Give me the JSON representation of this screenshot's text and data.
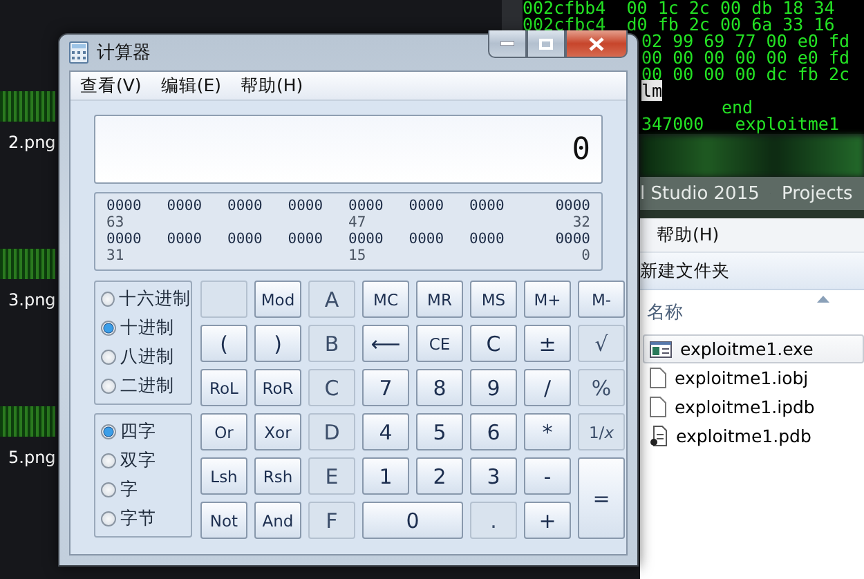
{
  "desktop_icons": [
    {
      "label": "2.png"
    },
    {
      "label": "3.png"
    },
    {
      "label": "5.png"
    }
  ],
  "terminal": {
    "lines": [
      {
        "text": "002cfbb4  00 1c 2c 00 db 18 34",
        "kind": "row",
        "highlighted": false
      },
      {
        "text": "002cfbc4  d0 fb 2c 00 6a 33 16",
        "kind": "row",
        "highlighted": false
      },
      {
        "text": "02 99 69 77 00 e0 fd",
        "kind": "tail",
        "highlighted": false
      },
      {
        "text": "00 00 00 00 00 e0 fd",
        "kind": "tail",
        "highlighted": false
      },
      {
        "text": "00 00 00 00 dc fb 2c",
        "kind": "tail",
        "highlighted": false
      },
      {
        "text": "lm",
        "kind": "tail",
        "highlighted": true
      },
      {
        "text": "end",
        "kind": "indented",
        "highlighted": false
      },
      {
        "text": "347000   exploitme1",
        "kind": "tail",
        "highlighted": false
      }
    ]
  },
  "explorer": {
    "breadcrumb": [
      "l Studio 2015",
      "Projects"
    ],
    "menu": [
      "帮助(H)"
    ],
    "toolbar": [
      "新建文件夹"
    ],
    "column": "名称",
    "files": [
      {
        "name": "exploitme1.exe",
        "kind": "exe",
        "selected": true
      },
      {
        "name": "exploitme1.iobj",
        "kind": "file",
        "selected": false
      },
      {
        "name": "exploitme1.ipdb",
        "kind": "file",
        "selected": false
      },
      {
        "name": "exploitme1.pdb",
        "kind": "pdb",
        "selected": false
      }
    ]
  },
  "window": {
    "title": "计算器"
  },
  "menu": [
    "查看(V)",
    "编辑(E)",
    "帮助(H)"
  ],
  "display": "0",
  "bits": [
    {
      "groups": [
        "0000",
        "0000",
        "0000",
        "0000",
        "0000",
        "0000",
        "0000",
        "0000"
      ],
      "labels": [
        "63",
        "47",
        "32"
      ]
    },
    {
      "groups": [
        "0000",
        "0000",
        "0000",
        "0000",
        "0000",
        "0000",
        "0000",
        "0000"
      ],
      "labels": [
        "31",
        "15",
        "0"
      ]
    }
  ],
  "bases": [
    {
      "label": "十六进制",
      "selected": false
    },
    {
      "label": "十进制",
      "selected": true
    },
    {
      "label": "八进制",
      "selected": false
    },
    {
      "label": "二进制",
      "selected": false
    }
  ],
  "word_sizes": [
    {
      "label": "四字",
      "selected": true
    },
    {
      "label": "双字",
      "selected": false
    },
    {
      "label": "字",
      "selected": false
    },
    {
      "label": "字节",
      "selected": false
    }
  ],
  "keys": [
    {
      "kind": "blank",
      "disabled": true
    },
    {
      "label": "Mod",
      "kind": "normal",
      "disabled": false
    },
    {
      "label": "A",
      "kind": "normal",
      "disabled": true
    },
    {
      "label": "MC",
      "kind": "normal",
      "disabled": false
    },
    {
      "label": "MR",
      "kind": "normal",
      "disabled": false
    },
    {
      "label": "MS",
      "kind": "normal",
      "disabled": false
    },
    {
      "label": "M+",
      "kind": "normal",
      "disabled": false
    },
    {
      "label": "M-",
      "kind": "normal",
      "disabled": false
    },
    {
      "label": "(",
      "kind": "normal",
      "disabled": false
    },
    {
      "label": ")",
      "kind": "normal",
      "disabled": false
    },
    {
      "label": "B",
      "kind": "normal",
      "disabled": true
    },
    {
      "label": "⟵",
      "kind": "normal",
      "disabled": false
    },
    {
      "label": "CE",
      "kind": "normal",
      "disabled": false
    },
    {
      "label": "C",
      "kind": "normal",
      "disabled": false
    },
    {
      "label": "±",
      "kind": "normal",
      "disabled": false
    },
    {
      "label": "√",
      "kind": "normal",
      "disabled": true
    },
    {
      "label": "RoL",
      "kind": "normal",
      "disabled": false
    },
    {
      "label": "RoR",
      "kind": "normal",
      "disabled": false
    },
    {
      "label": "C",
      "kind": "normal",
      "disabled": true
    },
    {
      "label": "7",
      "kind": "normal",
      "disabled": false
    },
    {
      "label": "8",
      "kind": "normal",
      "disabled": false
    },
    {
      "label": "9",
      "kind": "normal",
      "disabled": false
    },
    {
      "label": "/",
      "kind": "normal",
      "disabled": false
    },
    {
      "label": "%",
      "kind": "normal",
      "disabled": true
    },
    {
      "label": "Or",
      "kind": "normal",
      "disabled": false
    },
    {
      "label": "Xor",
      "kind": "normal",
      "disabled": false
    },
    {
      "label": "D",
      "kind": "normal",
      "disabled": true
    },
    {
      "label": "4",
      "kind": "normal",
      "disabled": false
    },
    {
      "label": "5",
      "kind": "normal",
      "disabled": false
    },
    {
      "label": "6",
      "kind": "normal",
      "disabled": false
    },
    {
      "label": "*",
      "kind": "normal",
      "disabled": false
    },
    {
      "label": "1/*x*",
      "kind": "normal",
      "disabled": true
    },
    {
      "label": "Lsh",
      "kind": "normal",
      "disabled": false
    },
    {
      "label": "Rsh",
      "kind": "normal",
      "disabled": false
    },
    {
      "label": "E",
      "kind": "normal",
      "disabled": true
    },
    {
      "label": "1",
      "kind": "normal",
      "disabled": false
    },
    {
      "label": "2",
      "kind": "normal",
      "disabled": false
    },
    {
      "label": "3",
      "kind": "normal",
      "disabled": false
    },
    {
      "label": "-",
      "kind": "normal",
      "disabled": false
    },
    {
      "label": "=",
      "kind": "tall",
      "disabled": false
    },
    {
      "label": "Not",
      "kind": "normal",
      "disabled": false
    },
    {
      "label": "And",
      "kind": "normal",
      "disabled": false
    },
    {
      "label": "F",
      "kind": "normal",
      "disabled": true
    },
    {
      "label": "0",
      "kind": "wide",
      "disabled": false
    },
    {
      "label": ".",
      "kind": "normal",
      "disabled": true
    },
    {
      "label": "+",
      "kind": "normal",
      "disabled": false
    }
  ]
}
